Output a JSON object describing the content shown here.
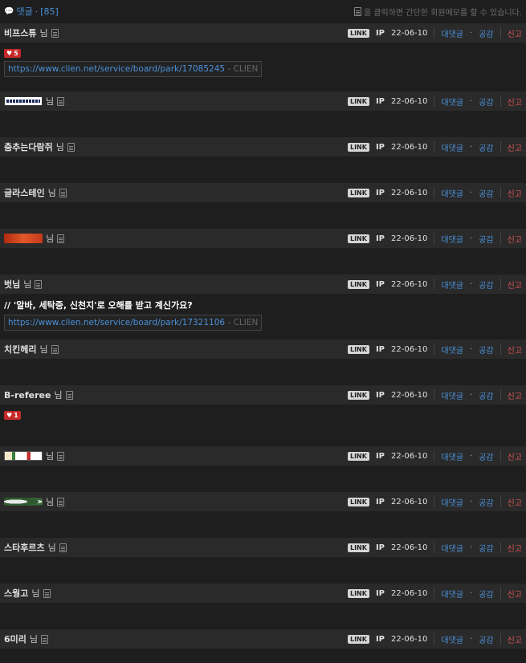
{
  "header": {
    "comment_label": "댓글",
    "comment_count": "[85]",
    "memo_hint": "을 클릭하면 간단한 회원메모를 할 수 있습니다."
  },
  "labels": {
    "nim": "님",
    "link": "LINK",
    "ip": "IP",
    "reply": "대댓글",
    "dot": "·",
    "like": "공감",
    "report": "신고"
  },
  "comments": [
    {
      "author": "비프스튜",
      "nick_image": false,
      "date": "22-06-10",
      "likes": "5",
      "url": "https://www.clien.net/service/board/park/17085245",
      "site": "- CLIEN"
    },
    {
      "author": "",
      "nick_image": "daydreamer-nick-image",
      "date": "22-06-10"
    },
    {
      "author": "춤추는다람쥐",
      "nick_image": false,
      "date": "22-06-10"
    },
    {
      "author": "글라스테인",
      "nick_image": false,
      "date": "22-06-10"
    },
    {
      "author": "",
      "nick_image": "crimson-nick-image",
      "date": "22-06-10"
    },
    {
      "author": "벗님",
      "nick_image": false,
      "date": "22-06-10",
      "text": "// '알바, 세탁중, 신천지'로 오해를 받고 계신가요?",
      "url": "https://www.clien.net/service/board/park/17321106",
      "site": "- CLIEN"
    },
    {
      "author": "치킨헤리",
      "nick_image": false,
      "date": "22-06-10"
    },
    {
      "author": "B-referee",
      "nick_image": false,
      "date": "22-06-10",
      "likes": "1"
    },
    {
      "author": "",
      "nick_image": "sonsoo-nick-image",
      "date": "22-06-10"
    },
    {
      "author": "",
      "nick_image": "green-nick-image",
      "date": "22-06-10"
    },
    {
      "author": "스타후르츠",
      "nick_image": false,
      "date": "22-06-10"
    },
    {
      "author": "스웡고",
      "nick_image": false,
      "date": "22-06-10"
    },
    {
      "author": "6미리",
      "nick_image": false,
      "date": "22-06-10"
    }
  ]
}
